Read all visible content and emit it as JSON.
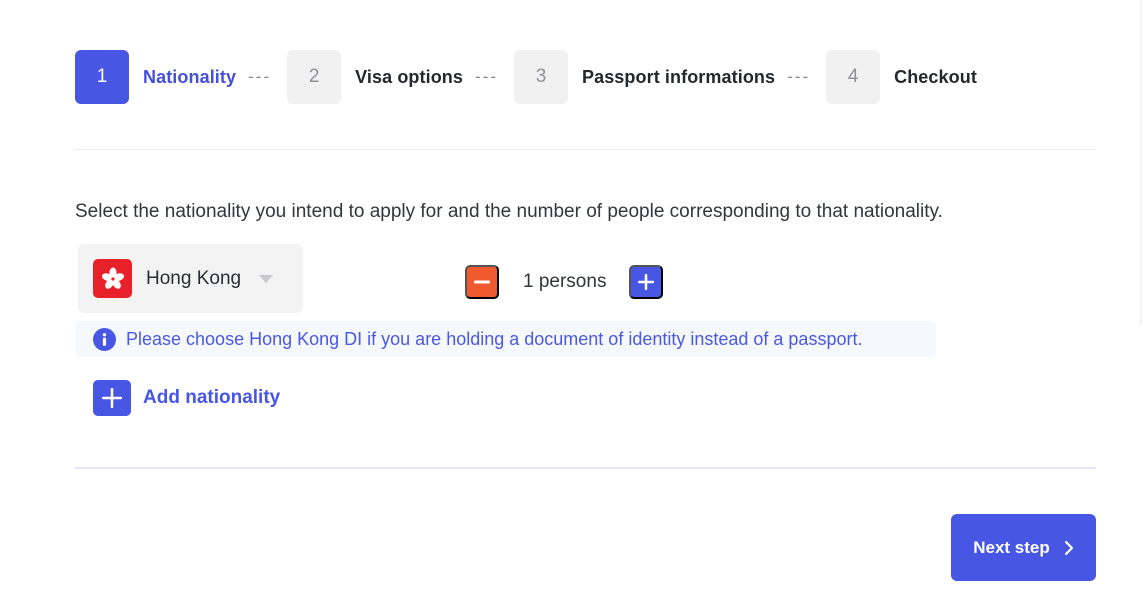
{
  "stepper": {
    "steps": [
      {
        "number": "1",
        "label": "Nationality",
        "active": true
      },
      {
        "number": "2",
        "label": "Visa options",
        "active": false
      },
      {
        "number": "3",
        "label": "Passport informations",
        "active": false
      },
      {
        "number": "4",
        "label": "Checkout",
        "active": false
      }
    ],
    "separator": "---"
  },
  "form": {
    "intro": "Select the nationality you intend to apply for and the number of people corresponding to that nationality.",
    "nationality": {
      "selected": "Hong Kong",
      "flag_icon": "hong-kong-flag-icon",
      "dropdown_icon": "caret-down-icon"
    },
    "quantity": {
      "value": 1,
      "label": "1 persons",
      "decrement_icon": "minus-icon",
      "increment_icon": "plus-icon"
    },
    "info": {
      "icon": "info-icon",
      "text": "Please choose Hong Kong DI if you are holding a document of identity instead of a passport."
    },
    "add_nationality": {
      "icon": "plus-icon",
      "label": "Add nationality"
    }
  },
  "footer": {
    "next_label": "Next step",
    "next_icon": "chevron-right-icon"
  },
  "colors": {
    "accent": "#4756e3",
    "decrement": "#f05a2e",
    "flag_red": "#e8202a",
    "info_bg": "#f5f9fd"
  }
}
